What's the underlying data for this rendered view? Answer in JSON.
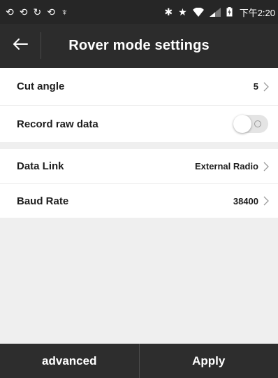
{
  "status_bar": {
    "time": "下午2:20",
    "left_icons": [
      "sync-icon",
      "sync-icon",
      "refresh-icon",
      "sync-icon",
      "usb-icon"
    ],
    "right_icons": [
      "bluetooth-icon",
      "star-icon",
      "wifi-icon",
      "signal-icon",
      "battery-icon"
    ]
  },
  "header": {
    "title": "Rover mode settings",
    "back_icon": "arrow-left-icon"
  },
  "settings": {
    "cut_angle": {
      "label": "Cut angle",
      "value": "5"
    },
    "record_raw_data": {
      "label": "Record raw data",
      "enabled": false
    },
    "data_link": {
      "label": "Data Link",
      "value": "External Radio"
    },
    "baud_rate": {
      "label": "Baud Rate",
      "value": "38400"
    }
  },
  "footer": {
    "advanced_label": "advanced",
    "apply_label": "Apply"
  },
  "colors": {
    "status_bar": "#262626",
    "title_bar": "#2c2c2c",
    "background": "#efefef",
    "bottom_bar": "#2d2d2d"
  }
}
